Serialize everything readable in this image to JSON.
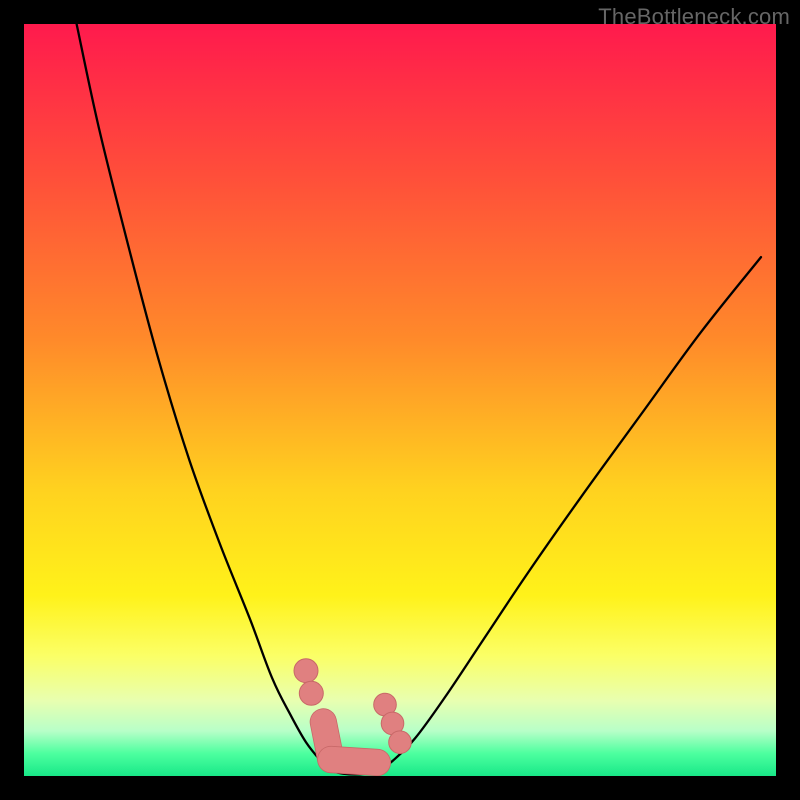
{
  "watermark": "TheBottleneck.com",
  "colors": {
    "black": "#000000",
    "curve": "#000000",
    "marker_fill": "#e08080",
    "marker_stroke": "#c86868",
    "gradient_stops": [
      {
        "offset": 0.0,
        "color": "#ff1a4d"
      },
      {
        "offset": 0.2,
        "color": "#ff4e3a"
      },
      {
        "offset": 0.42,
        "color": "#ff8a2a"
      },
      {
        "offset": 0.62,
        "color": "#ffd21f"
      },
      {
        "offset": 0.76,
        "color": "#fff21a"
      },
      {
        "offset": 0.84,
        "color": "#fbff66"
      },
      {
        "offset": 0.9,
        "color": "#e8ffb0"
      },
      {
        "offset": 0.94,
        "color": "#b8ffc8"
      },
      {
        "offset": 0.97,
        "color": "#4dff9f"
      },
      {
        "offset": 1.0,
        "color": "#18e888"
      }
    ]
  },
  "chart_data": {
    "type": "line",
    "title": "",
    "xlabel": "",
    "ylabel": "",
    "xlim": [
      0,
      100
    ],
    "ylim": [
      0,
      100
    ],
    "grid": false,
    "legend": false,
    "series": [
      {
        "name": "left-curve",
        "x": [
          7,
          10,
          14,
          18,
          22,
          26,
          30,
          33,
          35.5,
          37.5,
          39.5,
          41
        ],
        "y": [
          100,
          86,
          70,
          55,
          42,
          31,
          21,
          13,
          8,
          4.5,
          2,
          0.6
        ]
      },
      {
        "name": "right-curve",
        "x": [
          47,
          49,
          52,
          56,
          61,
          67,
          74,
          82,
          90,
          98
        ],
        "y": [
          0.6,
          2,
          5,
          10.5,
          18,
          27,
          37,
          48,
          59,
          69
        ]
      },
      {
        "name": "valley-floor",
        "x": [
          41,
          42.5,
          44,
          45.5,
          47
        ],
        "y": [
          0.6,
          0.3,
          0.2,
          0.3,
          0.6
        ]
      }
    ],
    "markers": [
      {
        "shape": "circle",
        "x": 37.5,
        "y": 14,
        "r": 1.6
      },
      {
        "shape": "circle",
        "x": 38.2,
        "y": 11,
        "r": 1.6
      },
      {
        "shape": "circle",
        "x": 48.0,
        "y": 9.5,
        "r": 1.5
      },
      {
        "shape": "circle",
        "x": 49.0,
        "y": 7.0,
        "r": 1.5
      },
      {
        "shape": "circle",
        "x": 50.0,
        "y": 4.5,
        "r": 1.5
      },
      {
        "shape": "capsule",
        "x1": 39.8,
        "y1": 7.2,
        "x2": 40.8,
        "y2": 2.2,
        "w": 3.4
      },
      {
        "shape": "capsule",
        "x1": 40.8,
        "y1": 2.2,
        "x2": 47.0,
        "y2": 1.8,
        "w": 3.4
      }
    ]
  }
}
